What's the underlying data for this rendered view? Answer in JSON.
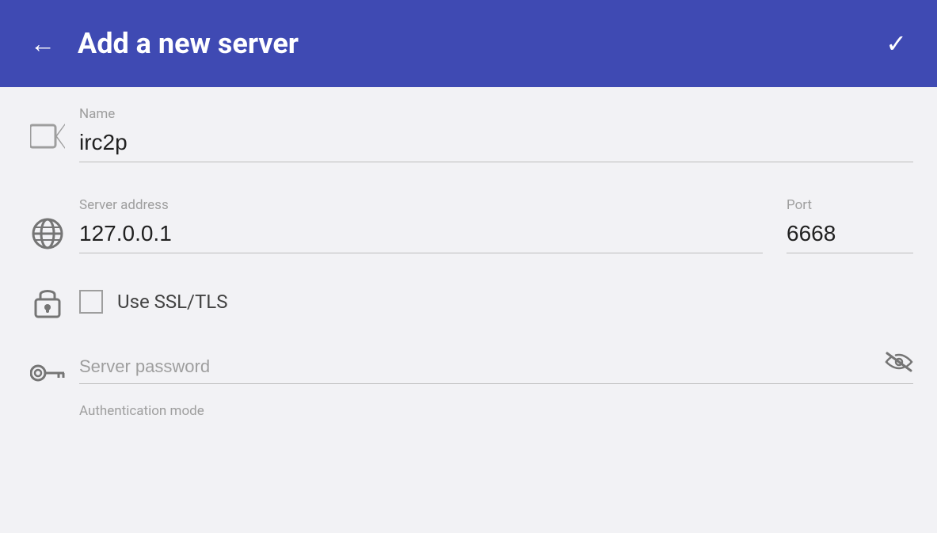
{
  "appBar": {
    "title": "Add a new server",
    "backLabel": "←",
    "confirmLabel": "✓",
    "accentColor": "#3f4ab3"
  },
  "form": {
    "nameSection": {
      "label": "Name",
      "value": "irc2p",
      "placeholder": ""
    },
    "serverAddressSection": {
      "addressLabel": "Server address",
      "addressValue": "127.0.0.1",
      "addressPlaceholder": "",
      "portLabel": "Port",
      "portValue": "6668",
      "portPlaceholder": ""
    },
    "sslSection": {
      "checkboxLabel": "Use SSL/TLS",
      "checked": false
    },
    "passwordSection": {
      "label": "",
      "placeholder": "Server password"
    },
    "authSection": {
      "label": "Authentication mode"
    }
  }
}
